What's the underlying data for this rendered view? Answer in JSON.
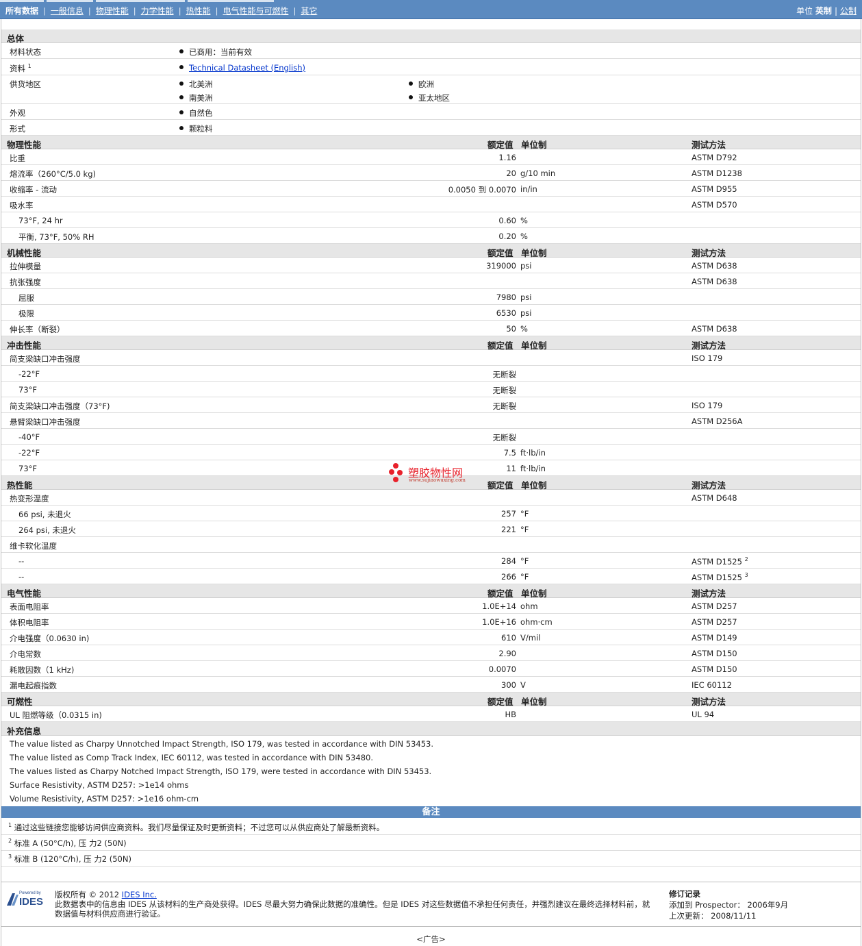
{
  "nav": {
    "tabs": [
      "所有数据",
      "一般信息",
      "物理性能",
      "力学性能",
      "热性能",
      "电气性能与可燃性",
      "其它"
    ],
    "units_label": "单位",
    "units_selected": "英制",
    "units_other": "公制"
  },
  "headers": {
    "nominal": "额定值",
    "unit": "单位制",
    "method": "测试方法"
  },
  "general": {
    "title": "总体",
    "rows": [
      {
        "label": "材料状态",
        "items": [
          "已商用：当前有效"
        ]
      },
      {
        "label": "资料",
        "sup": "1",
        "link": "Technical Datasheet (English)"
      },
      {
        "label": "供货地区",
        "items": [
          "北美洲",
          "欧洲",
          "南美洲",
          "亚太地区"
        ]
      },
      {
        "label": "外观",
        "items": [
          "自然色"
        ]
      },
      {
        "label": "形式",
        "items": [
          "颗粒料"
        ]
      }
    ]
  },
  "sections": [
    {
      "title": "物理性能",
      "rows": [
        {
          "label": "比重",
          "value": "1.16",
          "unit": "",
          "method": "ASTM D792"
        },
        {
          "label": "熔流率（260°C/5.0 kg)",
          "value": "20",
          "unit": "g/10 min",
          "method": "ASTM D1238"
        },
        {
          "label": "收缩率 - 流动",
          "value": "0.0050 到  0.0070",
          "unit": "in/in",
          "method": "ASTM D955"
        },
        {
          "label": "吸水率",
          "value": "",
          "unit": "",
          "method": "ASTM D570"
        },
        {
          "label": "73°F, 24 hr",
          "sub": true,
          "value": "0.60",
          "unit": "%",
          "method": ""
        },
        {
          "label": "平衡, 73°F, 50% RH",
          "sub": true,
          "value": "0.20",
          "unit": "%",
          "method": ""
        }
      ]
    },
    {
      "title": "机械性能",
      "rows": [
        {
          "label": "拉伸模量",
          "value": "319000",
          "unit": "psi",
          "method": "ASTM D638"
        },
        {
          "label": "抗张强度",
          "value": "",
          "unit": "",
          "method": "ASTM D638"
        },
        {
          "label": "屈服",
          "sub": true,
          "value": "7980",
          "unit": "psi",
          "method": ""
        },
        {
          "label": "极限",
          "sub": true,
          "value": "6530",
          "unit": "psi",
          "method": ""
        },
        {
          "label": "伸长率（断裂）",
          "value": "50",
          "unit": "%",
          "method": "ASTM D638"
        }
      ]
    },
    {
      "title": "冲击性能",
      "rows": [
        {
          "label": "简支梁缺口冲击强度",
          "value": "",
          "unit": "",
          "method": "ISO 179"
        },
        {
          "label": "-22°F",
          "sub": true,
          "value": "无断裂",
          "unit": "",
          "method": ""
        },
        {
          "label": "73°F",
          "sub": true,
          "value": "无断裂",
          "unit": "",
          "method": ""
        },
        {
          "label": "简支梁缺口冲击强度（73°F)",
          "value": "无断裂",
          "unit": "",
          "method": "ISO 179"
        },
        {
          "label": "悬臂梁缺口冲击强度",
          "value": "",
          "unit": "",
          "method": "ASTM D256A"
        },
        {
          "label": "-40°F",
          "sub": true,
          "value": "无断裂",
          "unit": "",
          "method": ""
        },
        {
          "label": "-22°F",
          "sub": true,
          "value": "7.5",
          "unit": "ft·lb/in",
          "method": ""
        },
        {
          "label": "73°F",
          "sub": true,
          "value": "11",
          "unit": "ft·lb/in",
          "method": ""
        }
      ]
    },
    {
      "title": "热性能",
      "rows": [
        {
          "label": "热变形温度",
          "value": "",
          "unit": "",
          "method": "ASTM D648"
        },
        {
          "label": "66 psi, 未退火",
          "sub": true,
          "value": "257",
          "unit": "°F",
          "method": ""
        },
        {
          "label": "264 psi, 未退火",
          "sub": true,
          "value": "221",
          "unit": "°F",
          "method": ""
        },
        {
          "label": "维卡软化温度",
          "value": "",
          "unit": "",
          "method": ""
        },
        {
          "label": "--",
          "sub": true,
          "value": "284",
          "unit": "°F",
          "method": "ASTM D1525",
          "msup": "2"
        },
        {
          "label": "--",
          "sub": true,
          "value": "266",
          "unit": "°F",
          "method": "ASTM D1525",
          "msup": "3"
        }
      ]
    },
    {
      "title": "电气性能",
      "rows": [
        {
          "label": "表面电阻率",
          "value": "1.0E+14",
          "unit": "ohm",
          "method": "ASTM D257"
        },
        {
          "label": "体积电阻率",
          "value": "1.0E+16",
          "unit": "ohm·cm",
          "method": "ASTM D257"
        },
        {
          "label": "介电强度（0.0630 in)",
          "value": "610",
          "unit": "V/mil",
          "method": "ASTM D149"
        },
        {
          "label": "介电常数",
          "value": "2.90",
          "unit": "",
          "method": "ASTM D150"
        },
        {
          "label": "耗散因数（1 kHz)",
          "value": "0.0070",
          "unit": "",
          "method": "ASTM D150"
        },
        {
          "label": "漏电起痕指数",
          "value": "300",
          "unit": "V",
          "method": "IEC 60112"
        }
      ]
    },
    {
      "title": "可燃性",
      "rows": [
        {
          "label": "UL 阻燃等级（0.0315 in)",
          "value": "HB",
          "unit": "",
          "method": "UL 94"
        }
      ]
    }
  ],
  "supplemental": {
    "title": "补充信息",
    "lines": [
      "The value listed as Charpy Unnotched Impact Strength, ISO 179, was tested in accordance with DIN 53453.",
      "The value listed as Comp Track Index, IEC 60112, was tested in accordance with DIN 53480.",
      "The values listed as Charpy Notched Impact Strength, ISO 179, were tested in accordance with DIN 53453.",
      "Surface Resistivity, ASTM D257: >1e14 ohms",
      "Volume Resistivity, ASTM D257: >1e16 ohm-cm"
    ]
  },
  "remarks": {
    "title": "备注",
    "items": [
      {
        "num": "1",
        "text": "通过这些链接您能够访问供应商资料。我们尽量保证及时更新资料；不过您可以从供应商处了解最新资料。"
      },
      {
        "num": "2",
        "text": "标准  A (50°C/h), 压  力2 (50N)"
      },
      {
        "num": "3",
        "text": "标准  B (120°C/h), 压  力2 (50N)"
      }
    ]
  },
  "footer": {
    "logo_top": "Powered by",
    "logo_main": "IDES",
    "copyright": "版权所有  © 2012",
    "company_link": "IDES Inc.",
    "disclaimer": "此数据表中的信息由  IDES 从该材料的生产商处获得。IDES 尽最大努力确保此数据的准确性。但是  IDES 对这些数据值不承担任何责任，并强烈建议在最终选择材料前，就数据值与材料供应商进行验证。",
    "rev_title": "修订记录",
    "added_label": "添加到  Prospector：",
    "added_date": "2006年9月",
    "updated_label": "上次更新：",
    "updated_date": "2008/11/11",
    "ad": "<广告>"
  },
  "watermark": {
    "cn": "塑胶物性网",
    "url": "www.sujiaowuxing.com"
  },
  "colors": {
    "bar": "#5b8ac0",
    "section_bg": "#e6e6e6",
    "link": "#0033cc"
  }
}
